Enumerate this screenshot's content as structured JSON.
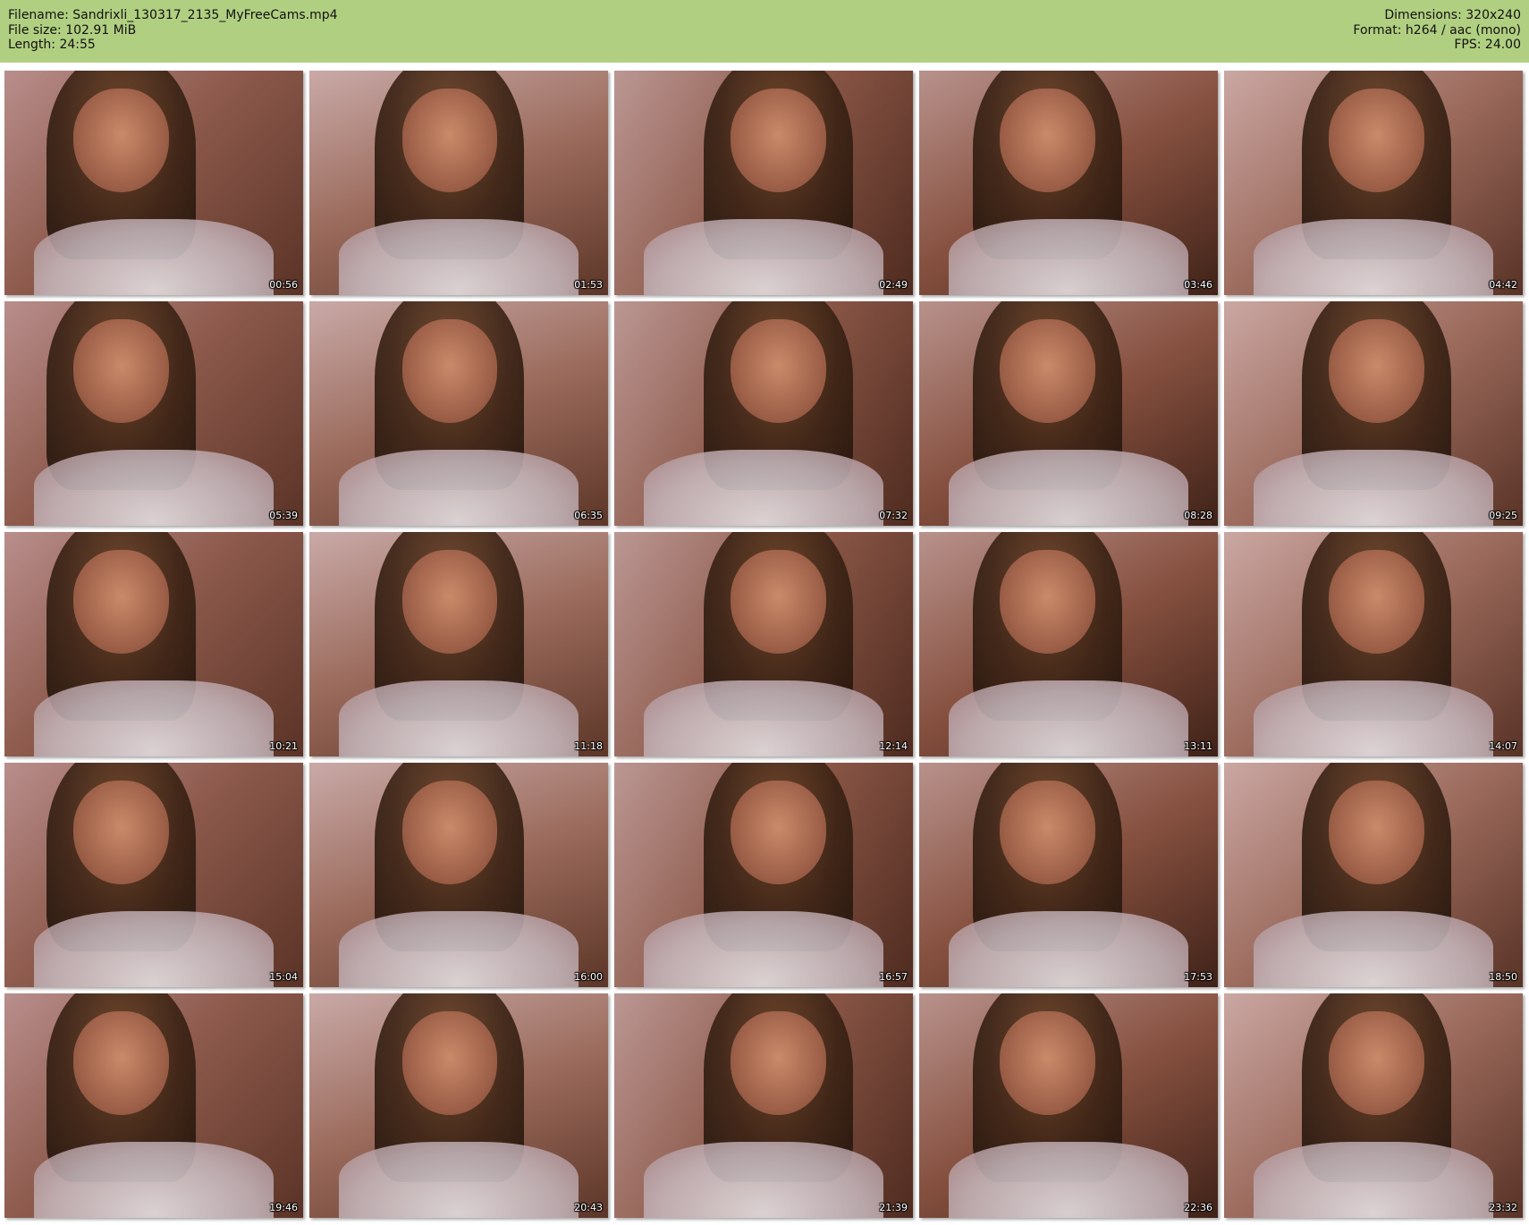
{
  "header": {
    "filename_line": "Filename: Sandrixli_130317_2135_MyFreeCams.mp4",
    "filesize_line": "File size: 102.91 MiB",
    "length_line": "Length: 24:55",
    "dimensions_line": "Dimensions: 320x240",
    "format_line": "Format: h264 / aac (mono)",
    "fps_line": "FPS: 24.00",
    "bar_color": "#b1cf81"
  },
  "grid": {
    "thumbnails": [
      {
        "time": "00:56"
      },
      {
        "time": "01:53"
      },
      {
        "time": "02:49"
      },
      {
        "time": "03:46"
      },
      {
        "time": "04:42"
      },
      {
        "time": "05:39"
      },
      {
        "time": "06:35"
      },
      {
        "time": "07:32"
      },
      {
        "time": "08:28"
      },
      {
        "time": "09:25"
      },
      {
        "time": "10:21"
      },
      {
        "time": "11:18"
      },
      {
        "time": "12:14"
      },
      {
        "time": "13:11"
      },
      {
        "time": "14:07"
      },
      {
        "time": "15:04"
      },
      {
        "time": "16:00"
      },
      {
        "time": "16:57"
      },
      {
        "time": "17:53"
      },
      {
        "time": "18:50"
      },
      {
        "time": "19:46"
      },
      {
        "time": "20:43"
      },
      {
        "time": "21:39"
      },
      {
        "time": "22:36"
      },
      {
        "time": "23:32"
      }
    ]
  }
}
